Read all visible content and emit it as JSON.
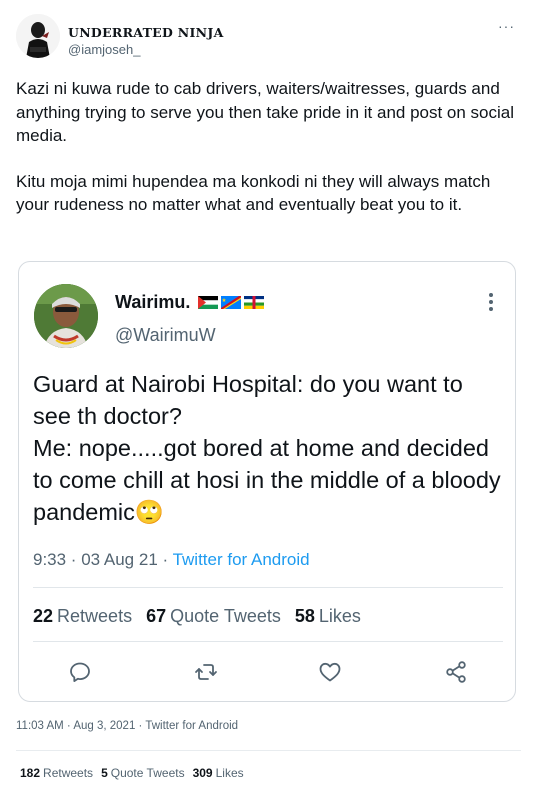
{
  "tweet": {
    "author_name": "UNDERRATED NINJA",
    "author_handle": "@iamjoseh_",
    "more_label": "···",
    "paragraphs": [
      "Kazi ni kuwa rude to cab drivers, waiters/waitresses, guards and anything trying to serve you then take pride in it and post on social media.",
      "Kitu moja mimi hupendea ma konkodi ni they will always match your rudeness no matter what and eventually beat you to it."
    ],
    "time_date": "11:03 AM · Aug 3, 2021 · ",
    "source": "Twitter for Android",
    "stats": {
      "retweets_count": "182",
      "retweets_label": "Retweets",
      "quotes_count": "5",
      "quotes_label": "Quote Tweets",
      "likes_count": "309",
      "likes_label": "Likes"
    }
  },
  "quoted": {
    "author_name": "Wairimu.",
    "author_handle": "@WairimuW",
    "flags": [
      "palestine-flag",
      "congo-flag",
      "central-african-republic-flag"
    ],
    "lines": [
      "Guard at Nairobi Hospital: do you want to see th doctor?",
      "Me: nope.....got bored at home and decided to come chill at hosi in the middle of a bloody pandemic🙄"
    ],
    "time_date": "9:33 · 03 Aug 21 · ",
    "source": "Twitter for Android",
    "stats": {
      "retweets_count": "22",
      "retweets_label": "Retweets",
      "quotes_count": "67",
      "quotes_label": "Quote Tweets",
      "likes_count": "58",
      "likes_label": "Likes"
    },
    "actions": [
      "reply-icon",
      "retweet-icon",
      "like-icon",
      "share-icon"
    ]
  },
  "colors": {
    "text": "#0f1419",
    "secondary": "#536471",
    "link": "#1d9bf0",
    "border": "#d6dbe0"
  }
}
